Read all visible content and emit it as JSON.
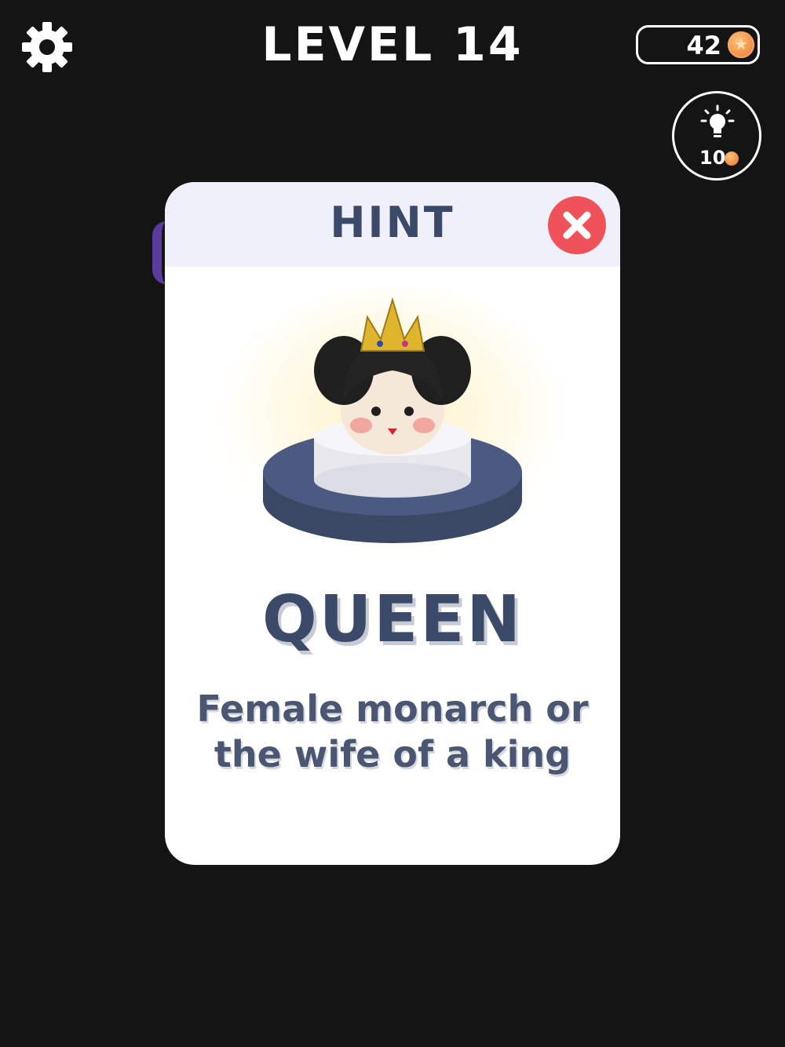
{
  "header": {
    "level_title": "LEVEL 14",
    "coins": "42",
    "hint_cost": "10"
  },
  "hint_modal": {
    "title": "HINT",
    "answer": "QUEEN",
    "description": "Female monarch or the wife of a king"
  },
  "icons": {
    "settings": "gear-icon",
    "coin": "coin-icon",
    "hint": "lightbulb-icon",
    "close": "close-icon"
  },
  "colors": {
    "background": "#141414",
    "modal_header": "#f0f0fa",
    "text_dark": "#3b4a68",
    "close_red": "#f0525a",
    "coin_orange": "#f0924a",
    "pedestal": "#46567a"
  }
}
